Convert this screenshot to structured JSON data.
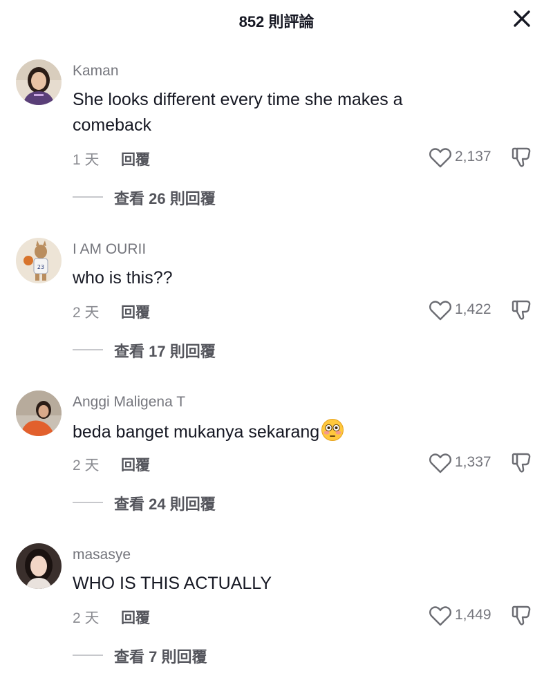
{
  "header": {
    "title": "852 則評論"
  },
  "comments": [
    {
      "username": "Kaman",
      "text_lines": [
        "She looks different every time she makes a",
        "comeback"
      ],
      "time": "1 天",
      "reply_label": "回覆",
      "likes": "2,137",
      "view_replies": "查看 26 則回覆"
    },
    {
      "username": "I AM OURII",
      "text": "who is this??",
      "time": "2 天",
      "reply_label": "回覆",
      "likes": "1,422",
      "view_replies": "查看 17 則回覆"
    },
    {
      "username": "Anggi Maligena T",
      "text": "beda banget mukanya sekarang",
      "emoji": "flushed-face-emoji",
      "time": "2 天",
      "reply_label": "回覆",
      "likes": "1,337",
      "view_replies": "查看 24 則回覆"
    },
    {
      "username": "masasye",
      "text": "WHO IS THIS ACTUALLY",
      "time": "2 天",
      "reply_label": "回覆",
      "likes": "1,449",
      "view_replies": "查看 7 則回覆"
    }
  ],
  "icons": {
    "close": "close-icon",
    "like": "heart-outline-icon",
    "dislike": "thumbs-down-icon"
  },
  "colors": {
    "text_primary": "#161823",
    "text_secondary": "#75767d",
    "divider": "#c7c8cc"
  }
}
